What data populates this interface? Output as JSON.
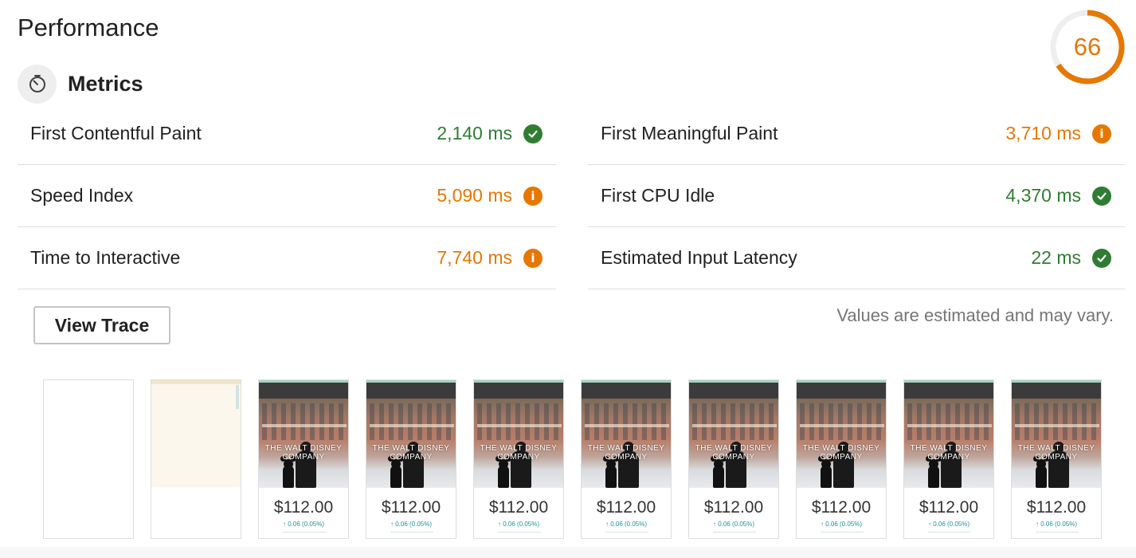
{
  "section": {
    "title": "Performance"
  },
  "score": {
    "value": "66",
    "fraction": 0.66,
    "color": "#e67700"
  },
  "metrics_header": {
    "title": "Metrics",
    "icon": "stopwatch-icon"
  },
  "metrics": [
    {
      "label": "First Contentful Paint",
      "value": "2,140 ms",
      "status": "pass",
      "icon": "check-circle-icon"
    },
    {
      "label": "First Meaningful Paint",
      "value": "3,710 ms",
      "status": "average",
      "icon": "info-circle-icon"
    },
    {
      "label": "Speed Index",
      "value": "5,090 ms",
      "status": "average",
      "icon": "info-circle-icon"
    },
    {
      "label": "First CPU Idle",
      "value": "4,370 ms",
      "status": "pass",
      "icon": "check-circle-icon"
    },
    {
      "label": "Time to Interactive",
      "value": "7,740 ms",
      "status": "average",
      "icon": "info-circle-icon"
    },
    {
      "label": "Estimated Input Latency",
      "value": "22 ms",
      "status": "pass",
      "icon": "check-circle-icon"
    }
  ],
  "colors": {
    "pass": "#2f7d32",
    "average": "#e67700"
  },
  "actions": {
    "view_trace_label": "View Trace"
  },
  "disclaimer": "Values are estimated and may vary.",
  "filmstrip": {
    "frames": [
      {
        "state": "blank"
      },
      {
        "state": "loading"
      },
      {
        "state": "loaded"
      },
      {
        "state": "loaded"
      },
      {
        "state": "loaded"
      },
      {
        "state": "loaded"
      },
      {
        "state": "loaded"
      },
      {
        "state": "loaded"
      },
      {
        "state": "loaded"
      },
      {
        "state": "loaded"
      }
    ],
    "screenshot": {
      "headline": "THE WALT DISNEY COMPANY",
      "price": "$112.00",
      "change": "↑ 0.06 (0.05%)"
    }
  }
}
